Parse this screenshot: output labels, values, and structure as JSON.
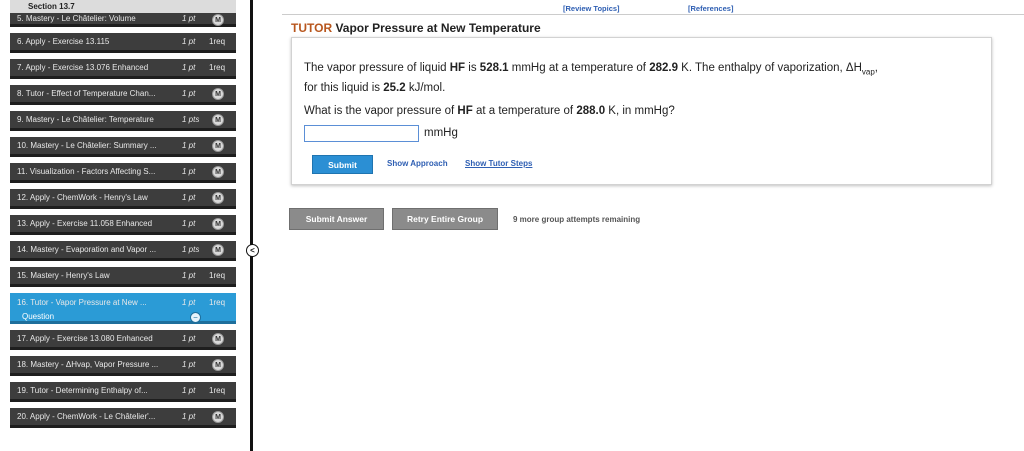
{
  "sidebar": {
    "section_title": "Section 13.7",
    "items": [
      {
        "label": "5. Mastery - Le Châtelier: Volume",
        "pts": "1 pt",
        "status": "mastery"
      },
      {
        "label": "6. Apply - Exercise 13.115",
        "pts": "1 pt",
        "status": "1req"
      },
      {
        "label": "7. Apply - Exercise 13.076 Enhanced",
        "pts": "1 pt",
        "status": "1req"
      },
      {
        "label": "8. Tutor - Effect of Temperature Chan...",
        "pts": "1 pt",
        "status": "mastery"
      },
      {
        "label": "9. Mastery - Le Châtelier: Temperature",
        "pts": "1 pts",
        "status": "mastery"
      },
      {
        "label": "10. Mastery - Le Châtelier: Summary ...",
        "pts": "1 pt",
        "status": "mastery"
      },
      {
        "label": "11. Visualization - Factors Affecting S...",
        "pts": "1 pt",
        "status": "mastery"
      },
      {
        "label": "12. Apply - ChemWork - Henry's Law",
        "pts": "1 pt",
        "status": "mastery"
      },
      {
        "label": "13. Apply - Exercise 11.058 Enhanced",
        "pts": "1 pt",
        "status": "mastery"
      },
      {
        "label": "14. Mastery - Evaporation and Vapor ...",
        "pts": "1 pts",
        "status": "mastery"
      },
      {
        "label": "15. Mastery - Henry's Law",
        "pts": "1 pt",
        "status": "1req"
      },
      {
        "label": "16. Tutor - Vapor Pressure at New ...",
        "pts": "1 pt",
        "status": "1req",
        "active": true
      },
      {
        "label": "17. Apply - Exercise 13.080 Enhanced",
        "pts": "1 pt",
        "status": "mastery"
      },
      {
        "label": "18. Mastery - ΔHvap, Vapor Pressure ...",
        "pts": "1 pt",
        "status": "mastery"
      },
      {
        "label": "19. Tutor - Determining Enthalpy of...",
        "pts": "1 pt",
        "status": "1req"
      },
      {
        "label": "20. Apply - ChemWork - Le Châtelier'...",
        "pts": "1 pt",
        "status": "mastery"
      }
    ],
    "active_sub_label": "Question",
    "mastery_badge": "M",
    "req_text": "1req",
    "collapse_glyph": "<"
  },
  "top_links": {
    "review": "[Review Topics]",
    "references": "[References]"
  },
  "tutor": {
    "tag": "TUTOR",
    "title": "Vapor Pressure at New Temperature"
  },
  "question": {
    "l1_a": "The vapor pressure of liquid ",
    "l1_hf": "HF",
    "l1_b": " is ",
    "l1_p": "528.1",
    "l1_c": " mmHg at a temperature of ",
    "l1_t": "282.9",
    "l1_d": " K. The enthalpy of vaporization, ΔH",
    "l1_sub": "vap",
    "l1_e": ",",
    "l2_a": "for this liquid is ",
    "l2_h": "25.2",
    "l2_b": " kJ/mol.",
    "l3_a": "What is the vapor pressure of ",
    "l3_hf": "HF",
    "l3_b": " at a temperature of ",
    "l3_t": "288.0",
    "l3_c": " K, in mmHg?",
    "input_value": "",
    "unit": "mmHg",
    "submit_label": "Submit",
    "show_approach": "Show Approach",
    "show_tutor_steps": "Show Tutor Steps"
  },
  "footer": {
    "submit_answer": "Submit Answer",
    "retry_group": "Retry Entire Group",
    "attempts_text": "9 more group attempts remaining"
  },
  "colors": {
    "sidebar_item_bg": "#3d3d3d",
    "active_item_bg": "#2b9bd6",
    "tutor_tag": "#b8561d",
    "link_blue": "#2f5fb3",
    "submit_blue": "#2b8fd4",
    "gray_button": "#8b8b8b"
  }
}
